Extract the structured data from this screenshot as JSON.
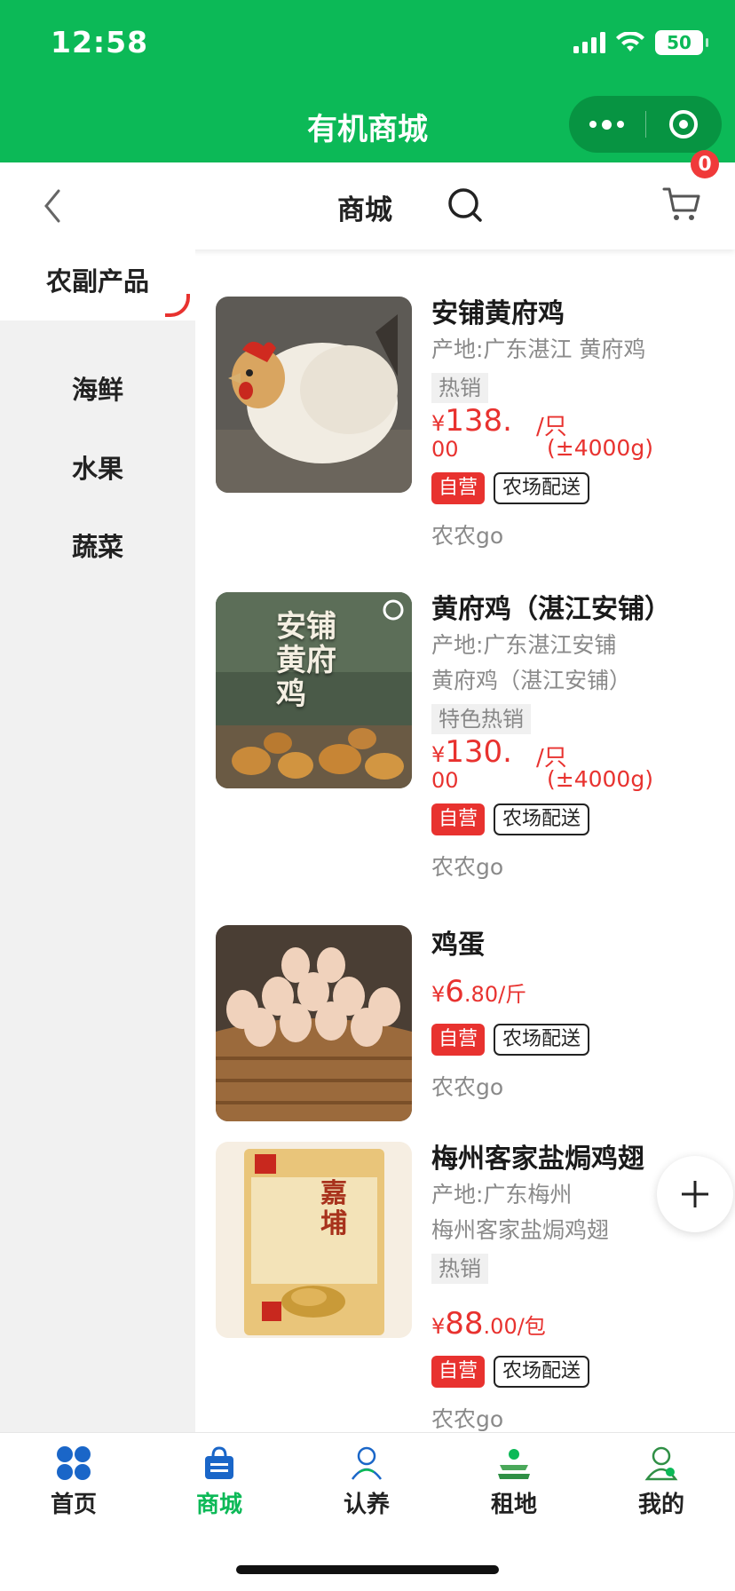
{
  "status_bar": {
    "time": "12:58",
    "battery": "50"
  },
  "app": {
    "title": "有机商城"
  },
  "nav": {
    "title": "商城",
    "cart_count": "0"
  },
  "categories": [
    {
      "label": "农副产品",
      "active": true
    },
    {
      "label": "海鲜",
      "active": false
    },
    {
      "label": "水果",
      "active": false
    },
    {
      "label": "蔬菜",
      "active": false
    }
  ],
  "products": [
    {
      "name": "安铺黄府鸡",
      "origin": "产地:广东湛江 黄府鸡",
      "tag": "热销",
      "price_main": "138.",
      "price_cents": "00",
      "price_unit": "/只",
      "price_weight": "(±4000g)",
      "badge_self": "自营",
      "badge_farm": "农场配送",
      "shop": "农农go"
    },
    {
      "name": "黄府鸡（湛江安铺）",
      "origin": "产地:广东湛江安铺",
      "origin2": "黄府鸡（湛江安铺）",
      "tag": "特色热销",
      "price_main": "130.",
      "price_cents": "00",
      "price_unit": "/只",
      "price_weight": "(±4000g)",
      "badge_self": "自营",
      "badge_farm": "农场配送",
      "shop": "农农go",
      "image_text": "安铺黄府鸡"
    },
    {
      "name": "鸡蛋",
      "price_big": "6",
      "price_rest": ".80/斤",
      "badge_self": "自营",
      "badge_farm": "农场配送",
      "shop": "农农go"
    },
    {
      "name": "梅州客家盐焗鸡翅",
      "origin": "产地:广东梅州",
      "origin2": "梅州客家盐焗鸡翅",
      "tag": "热销",
      "price_big": "88",
      "price_rest": ".00/包",
      "badge_self": "自营",
      "badge_farm": "农场配送",
      "shop": "农农go",
      "image_text": "嘉埔"
    }
  ],
  "currency": "¥",
  "tabs": [
    {
      "label": "首页",
      "icon": "home-grid-icon"
    },
    {
      "label": "商城",
      "icon": "shop-bag-icon",
      "active": true
    },
    {
      "label": "认养",
      "icon": "adopt-icon"
    },
    {
      "label": "租地",
      "icon": "land-rent-icon"
    },
    {
      "label": "我的",
      "icon": "profile-icon"
    }
  ],
  "colors": {
    "brand_green": "#0cb957",
    "price_red": "#e8322f"
  }
}
